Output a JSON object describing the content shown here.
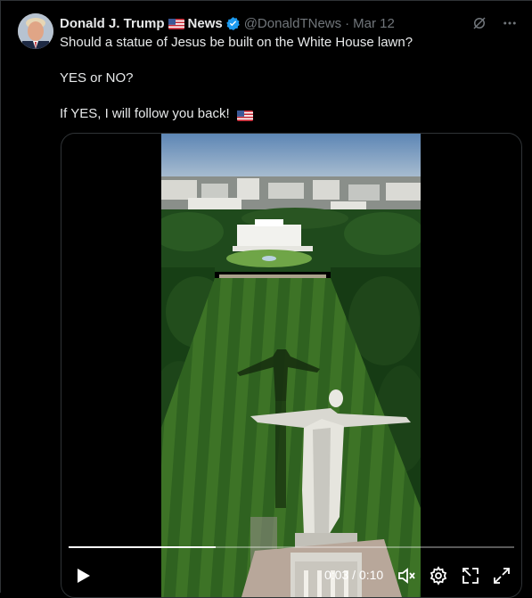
{
  "tweet": {
    "author_name": "Donald J. Trump",
    "author_suffix": "News",
    "handle": "@DonaldTNews",
    "separator": "·",
    "time": "Mar 12",
    "line1": "Should a statue of Jesus be built on the White House lawn?",
    "line2": "YES or NO?",
    "line3": "If YES, I will follow you back!"
  },
  "video": {
    "time_display": "0:03 / 0:10",
    "progress_fraction": 0.33
  },
  "icons": {
    "verified": "verified-badge-icon",
    "grok": "grok-icon",
    "more": "more-options-icon",
    "play": "play-icon",
    "mute": "volume-muted-icon",
    "settings": "gear-icon",
    "popout": "picture-in-picture-icon",
    "fullscreen": "fullscreen-icon"
  },
  "colors": {
    "background": "#000000",
    "text": "#e7e9ea",
    "secondary": "#71767b",
    "verified": "#1d9bf0"
  }
}
